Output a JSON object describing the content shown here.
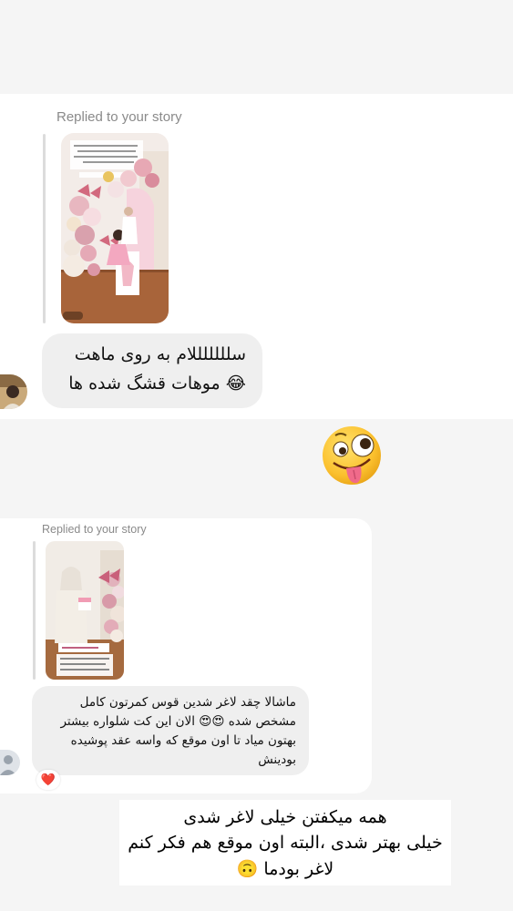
{
  "first_message": {
    "replied_label": "Replied to your story",
    "story_caption": "خواب",
    "text_line1": "سلللللللام به روی ماهت",
    "text_line2": "موهات قشگ شده ها",
    "emoji": "😂"
  },
  "sticker": {
    "emoji": "🤪",
    "name": "zany-face"
  },
  "second_message": {
    "replied_label": "Replied to your story",
    "story_tag": "@ahad_hahaei",
    "text_line1": "ماشالا چقد لاغر شدین قوس کمرتون کامل",
    "text_line2": "مشخص شده 😍😍 الان این کت شلواره بیشتر",
    "text_line3": "بهتون میاد تا اون موقع که واسه عقد پوشیده",
    "text_line4": "بودینش",
    "reaction": "❤️"
  },
  "reply_text": {
    "line1": "همه میکفتن خیلی لاغر شدی",
    "line2": "خیلی بهتر شدی ،البته اون موقع هم فکر کنم",
    "line3": "لاغر بودما 🙃"
  },
  "colors": {
    "bubble": "#efefef",
    "meta_text": "#8a8a8a",
    "background": "#f5f5f5",
    "reaction_heart": "#e0245e"
  }
}
